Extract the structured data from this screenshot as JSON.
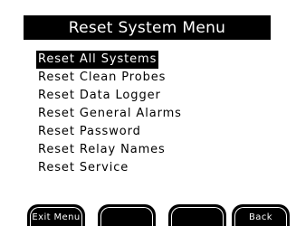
{
  "title": "Reset System Menu",
  "menu": {
    "items": [
      {
        "label": "Reset All Systems"
      },
      {
        "label": "Reset Clean Probes"
      },
      {
        "label": "Reset Data Logger"
      },
      {
        "label": "Reset General Alarms"
      },
      {
        "label": "Reset Password"
      },
      {
        "label": "Reset Relay Names"
      },
      {
        "label": "Reset Service"
      }
    ],
    "selected_label": "Reset All Systems"
  },
  "softkeys": {
    "key1": "Exit Menu",
    "key2": "",
    "key3": "",
    "key4": "Back"
  },
  "colors": {
    "background": "#ffffff",
    "foreground": "#000000",
    "highlight": "#000000"
  }
}
